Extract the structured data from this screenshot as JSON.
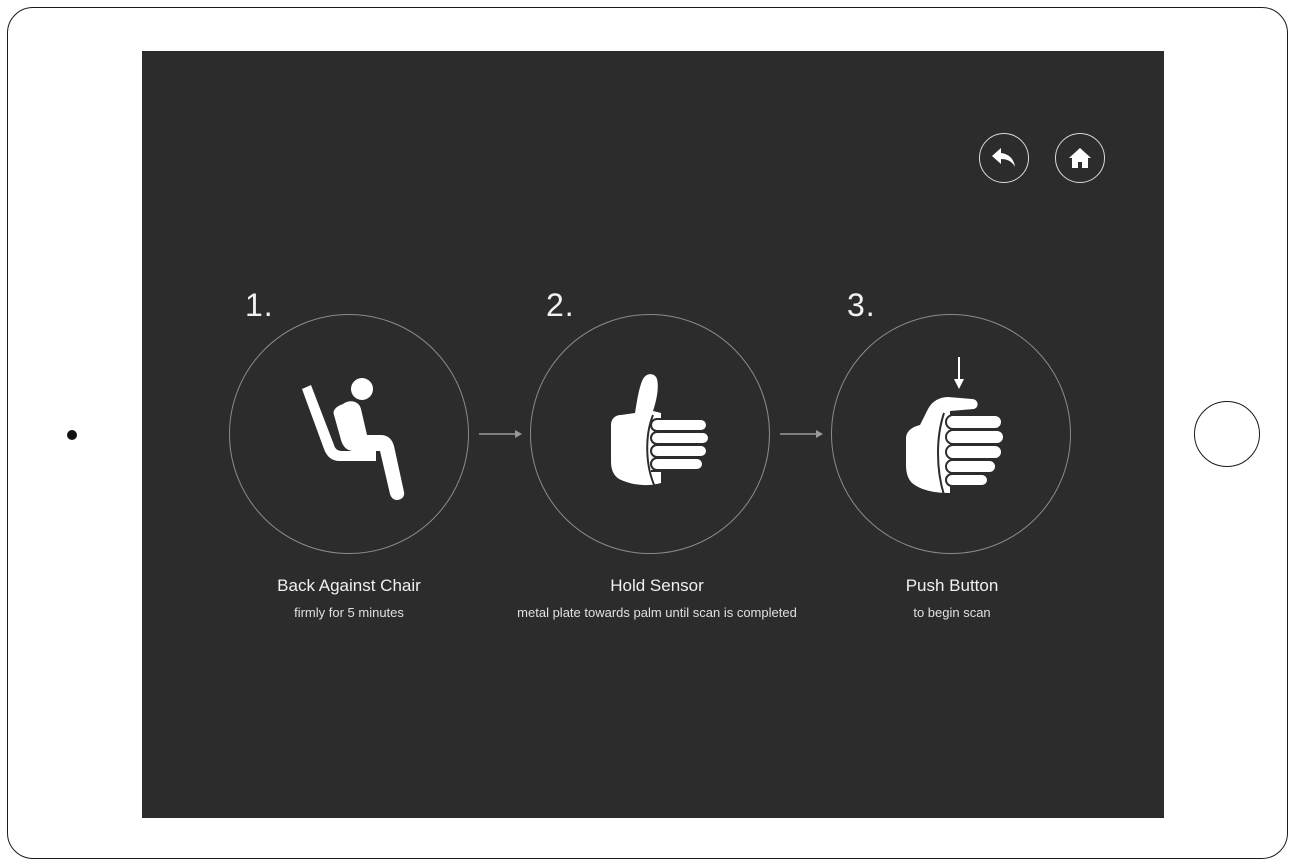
{
  "device": {
    "frame_color": "#1a1a1a",
    "screen_color": "#2d2c2c"
  },
  "nav": {
    "back_icon": "back-arrow-icon",
    "home_icon": "home-icon",
    "icon_color": "#ffffff"
  },
  "steps": [
    {
      "number": "1.",
      "title": "Back Against Chair",
      "subtitle": "firmly for 5 minutes",
      "icon": "seated-person-icon"
    },
    {
      "number": "2.",
      "title": "Hold Sensor",
      "subtitle": "metal plate towards palm until scan is completed",
      "icon": "thumbs-up-grip-icon"
    },
    {
      "number": "3.",
      "title": "Push Button",
      "subtitle": "to begin scan",
      "icon": "press-button-icon"
    }
  ],
  "connector_icon": "right-arrow-icon"
}
